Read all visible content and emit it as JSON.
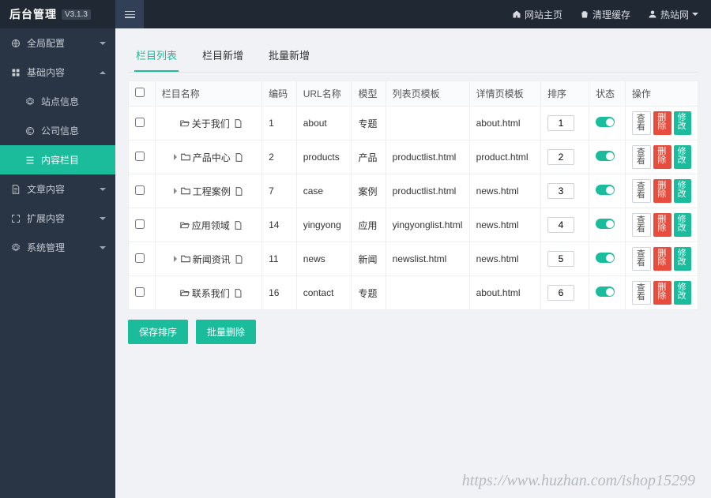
{
  "topbar": {
    "brand_title": "后台管理",
    "brand_version": "V3.1.3",
    "links": {
      "home": "网站主页",
      "clear_cache": "清理缓存",
      "user": "热站网"
    }
  },
  "sidebar": {
    "items": [
      {
        "icon": "globe",
        "label": "全局配置",
        "caret": "down"
      },
      {
        "icon": "grid",
        "label": "基础内容",
        "caret": "up",
        "expanded": true,
        "subs": [
          {
            "icon": "gear",
            "label": "站点信息"
          },
          {
            "icon": "copyright",
            "label": "公司信息"
          },
          {
            "icon": "list",
            "label": "内容栏目",
            "active": true
          }
        ]
      },
      {
        "icon": "doc",
        "label": "文章内容",
        "caret": "down"
      },
      {
        "icon": "expand",
        "label": "扩展内容",
        "caret": "down"
      },
      {
        "icon": "gear",
        "label": "系统管理",
        "caret": "down"
      }
    ]
  },
  "tabs": {
    "list": "栏目列表",
    "add": "栏目新增",
    "batch_add": "批量新增"
  },
  "table": {
    "headers": {
      "name": "栏目名称",
      "code": "编码",
      "url": "URL名称",
      "model": "模型",
      "list_tpl": "列表页模板",
      "detail_tpl": "详情页模板",
      "sort": "排序",
      "status": "状态",
      "ops": "操作"
    },
    "rows": [
      {
        "indent": 20,
        "arrow": false,
        "icon": "folder-open",
        "name": "关于我们",
        "doc": true,
        "code": "1",
        "url": "about",
        "model": "专题",
        "list_tpl": "",
        "detail_tpl": "about.html",
        "sort": "1",
        "status": true
      },
      {
        "indent": 12,
        "arrow": true,
        "icon": "folder",
        "name": "产品中心",
        "doc": true,
        "code": "2",
        "url": "products",
        "model": "产品",
        "list_tpl": "productlist.html",
        "detail_tpl": "product.html",
        "sort": "2",
        "status": true
      },
      {
        "indent": 12,
        "arrow": true,
        "icon": "folder",
        "name": "工程案例",
        "doc": true,
        "code": "7",
        "url": "case",
        "model": "案例",
        "list_tpl": "productlist.html",
        "detail_tpl": "news.html",
        "sort": "3",
        "status": true
      },
      {
        "indent": 20,
        "arrow": false,
        "icon": "folder-open",
        "name": "应用领域",
        "doc": true,
        "code": "14",
        "url": "yingyong",
        "model": "应用",
        "list_tpl": "yingyonglist.html",
        "detail_tpl": "news.html",
        "sort": "4",
        "status": true
      },
      {
        "indent": 12,
        "arrow": true,
        "icon": "folder",
        "name": "新闻资讯",
        "doc": true,
        "code": "11",
        "url": "news",
        "model": "新闻",
        "list_tpl": "newslist.html",
        "detail_tpl": "news.html",
        "sort": "5",
        "status": true
      },
      {
        "indent": 20,
        "arrow": false,
        "icon": "folder-open",
        "name": "联系我们",
        "doc": true,
        "code": "16",
        "url": "contact",
        "model": "专题",
        "list_tpl": "",
        "detail_tpl": "about.html",
        "sort": "6",
        "status": true
      }
    ],
    "row_ops": {
      "view": "查看",
      "delete": "删除",
      "edit": "修改"
    }
  },
  "actions": {
    "save_sort": "保存排序",
    "batch_delete": "批量删除"
  },
  "watermark": "https://www.huzhan.com/ishop15299"
}
